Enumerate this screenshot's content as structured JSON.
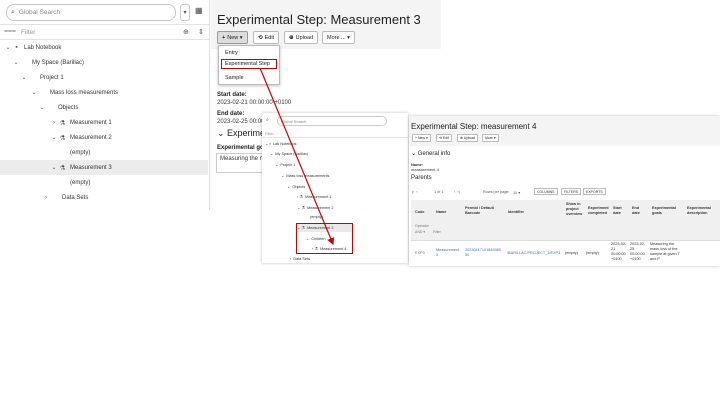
{
  "left_panel": {
    "search_placeholder": "Global Search",
    "filter_placeholder": "Filter",
    "tree": [
      {
        "label": "Lab Notebook",
        "chevron": "⌄",
        "icon": "▪"
      },
      {
        "label": "My Space (Barillac)",
        "chevron": "⌄",
        "icon": ""
      },
      {
        "label": "Project 1",
        "chevron": "⌄",
        "icon": ""
      },
      {
        "label": "Mass loss measurements",
        "chevron": "⌄",
        "icon": ""
      },
      {
        "label": "Objects",
        "chevron": "⌄",
        "icon": ""
      },
      {
        "label": "Measurement 1",
        "chevron": "›",
        "icon": "⚗"
      },
      {
        "label": "Measurement 2",
        "chevron": "⌄",
        "icon": "⚗"
      },
      {
        "label": "(empty)",
        "chevron": "",
        "icon": ""
      },
      {
        "label": "Measurement 3",
        "chevron": "⌄",
        "icon": "⚗"
      },
      {
        "label": "(empty)",
        "chevron": "",
        "icon": ""
      },
      {
        "label": "Data Sets",
        "chevron": "›",
        "icon": ""
      }
    ]
  },
  "step": {
    "title": "Experimental Step: Measurement 3",
    "toolbar": {
      "new": "New",
      "edit": "Edit",
      "upload": "Upload",
      "more": "More ..."
    },
    "new_menu": [
      "Entry",
      "Experimental Step",
      "Sample"
    ],
    "start_date_label": "Start date:",
    "start_date": "2023-02-21 00:00:00 +0100",
    "end_date_label": "End date:",
    "end_date": "2023-02-25 00:00",
    "section_title": "Experime",
    "goals_label": "Experimental goa",
    "goals_value": "Measuring the m"
  },
  "middle_panel": {
    "search_placeholder": "Global Search",
    "filter_placeholder": "Filter",
    "tree": [
      "Lab Notebook",
      "My Space (Barillac)",
      "Project 1",
      "Mass loss measurements",
      "Objects",
      "Measurement 1",
      "Measurement 2",
      "(empty)",
      "Measurement 3",
      "Children",
      "Measurement 4",
      "Data Sets"
    ]
  },
  "right_panel": {
    "title": "Experimental Step: measurement 4",
    "toolbar": {
      "new": "New",
      "edit": "Edit",
      "upload": "Upload",
      "more": "More"
    },
    "general_info": "General info",
    "name_label": "Name:",
    "name_value": "measurement 4",
    "parents": "Parents",
    "pager": "1 of 1",
    "rows_per_page": "Rows per page:",
    "rows_value": "10",
    "columns_btn": "COLUMNS",
    "filters_btn": "FILTERS",
    "exports_btn": "EXPORTS",
    "columns": [
      "Code",
      "Name",
      "Permid / Default\nBarcode",
      "Identifier",
      "Show in\nproject\noverview",
      "Experiment\ncompleted",
      "Start\ndate",
      "End\ndate",
      "Experimental\ngoals",
      "Experimental\ndescription"
    ],
    "sub_header_1": "Operator",
    "sub_header_2": "AND",
    "sub_header_3": "Filter",
    "row": [
      "EXP3",
      "Measurement\n3",
      "20230417101849080\n50",
      "/BARILLAC/PROJECT_1/EXP3",
      "(empty)",
      "(empty)",
      "2023-02-\n21\n00:00:00\n+0100",
      "2023-02-\n25\n00:00:00\n+0100",
      "Measuring the\nmass loss of the\nsample at given T\nand P",
      ""
    ]
  },
  "colors": {
    "highlight": "#cc0000",
    "link": "#3a6fb5",
    "header_bg": "#f4f4f4"
  }
}
